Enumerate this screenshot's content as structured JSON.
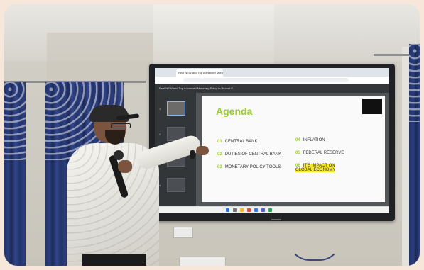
{
  "browser": {
    "tab_title": "Real NEW and Top Advanced Monetary Policy",
    "address": "",
    "doc_name": "Real NEW and Top Advanced Monetary Policy in Recent E..."
  },
  "slide": {
    "title": "Agenda",
    "subtitle": "",
    "items_left": [
      {
        "num": "01",
        "text": "CENTRAL BANK"
      },
      {
        "num": "02",
        "text": "DUTIES OF CENTRAL BANK"
      },
      {
        "num": "03",
        "text": "MONETARY POLICY TOOLS"
      }
    ],
    "items_right": [
      {
        "num": "04",
        "text": "INFLATION"
      },
      {
        "num": "05",
        "text": "FEDERAL RESERVE"
      },
      {
        "num": "06",
        "text": "IT'S IMPACT ON GLOBAL ECONOMY"
      }
    ],
    "accent_color": "#9ccd2f",
    "highlight_color": "#f7e92a"
  },
  "thumbnails": [
    "1",
    "2",
    "3",
    "4"
  ],
  "colors": {
    "background": "#f6e7da",
    "curtain": "#23336a"
  }
}
